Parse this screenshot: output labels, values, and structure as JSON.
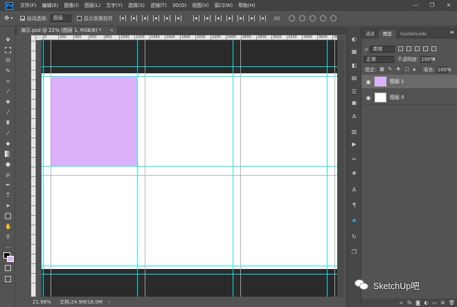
{
  "app": {
    "logo": "Ps"
  },
  "menu": [
    "文件(F)",
    "编辑(E)",
    "图像(I)",
    "图层(L)",
    "文字(Y)",
    "选择(S)",
    "滤镜(T)",
    "3D(D)",
    "视图(V)",
    "窗口(W)",
    "帮助(H)"
  ],
  "window_controls": {
    "minimize": "—",
    "restore": "❐",
    "close": "✕"
  },
  "options_bar": {
    "auto_select_label": "自动选择:",
    "auto_select_value": "图层",
    "show_transform_label": "显示变换控件"
  },
  "document": {
    "tab_title": "演示.psd @ 22% (图层 1, RGB/8) *",
    "tab_close": "×"
  },
  "ruler": {
    "h_ticks": [
      "0",
      "200",
      "400",
      "600",
      "800",
      "1000",
      "1200",
      "1400",
      "1600",
      "1800",
      "2000",
      "2200",
      "2400",
      "2600",
      "2800",
      "3000",
      "3200",
      "3400",
      "3600",
      "3800"
    ]
  },
  "status": {
    "zoom": "21.98%",
    "doc_size": "文档:24.9M/16.0M",
    "arrow": "›"
  },
  "panel": {
    "tabs": [
      "通道",
      "图层",
      "GuideGuide"
    ],
    "active_tab": "图层",
    "menu": "≡",
    "filter_kind": "类型",
    "blend_mode": "正常",
    "opacity_label": "不透明度:",
    "opacity_value": "100%",
    "lock_label": "锁定:",
    "fill_label": "填充:",
    "fill_value": "100%",
    "layers": [
      {
        "name": "图层 1",
        "thumb_color": "#dcb0fa",
        "selected": true
      },
      {
        "name": "图层 0",
        "thumb_color": "#ffffff",
        "selected": false
      }
    ]
  },
  "watermark": {
    "text": "SketchUp吧"
  },
  "colors": {
    "canvas_fill": "#dcb0fa",
    "guide": "#4fd6d6",
    "foreground_swatch": "#000000",
    "background_swatch": "#dcb0fa"
  }
}
